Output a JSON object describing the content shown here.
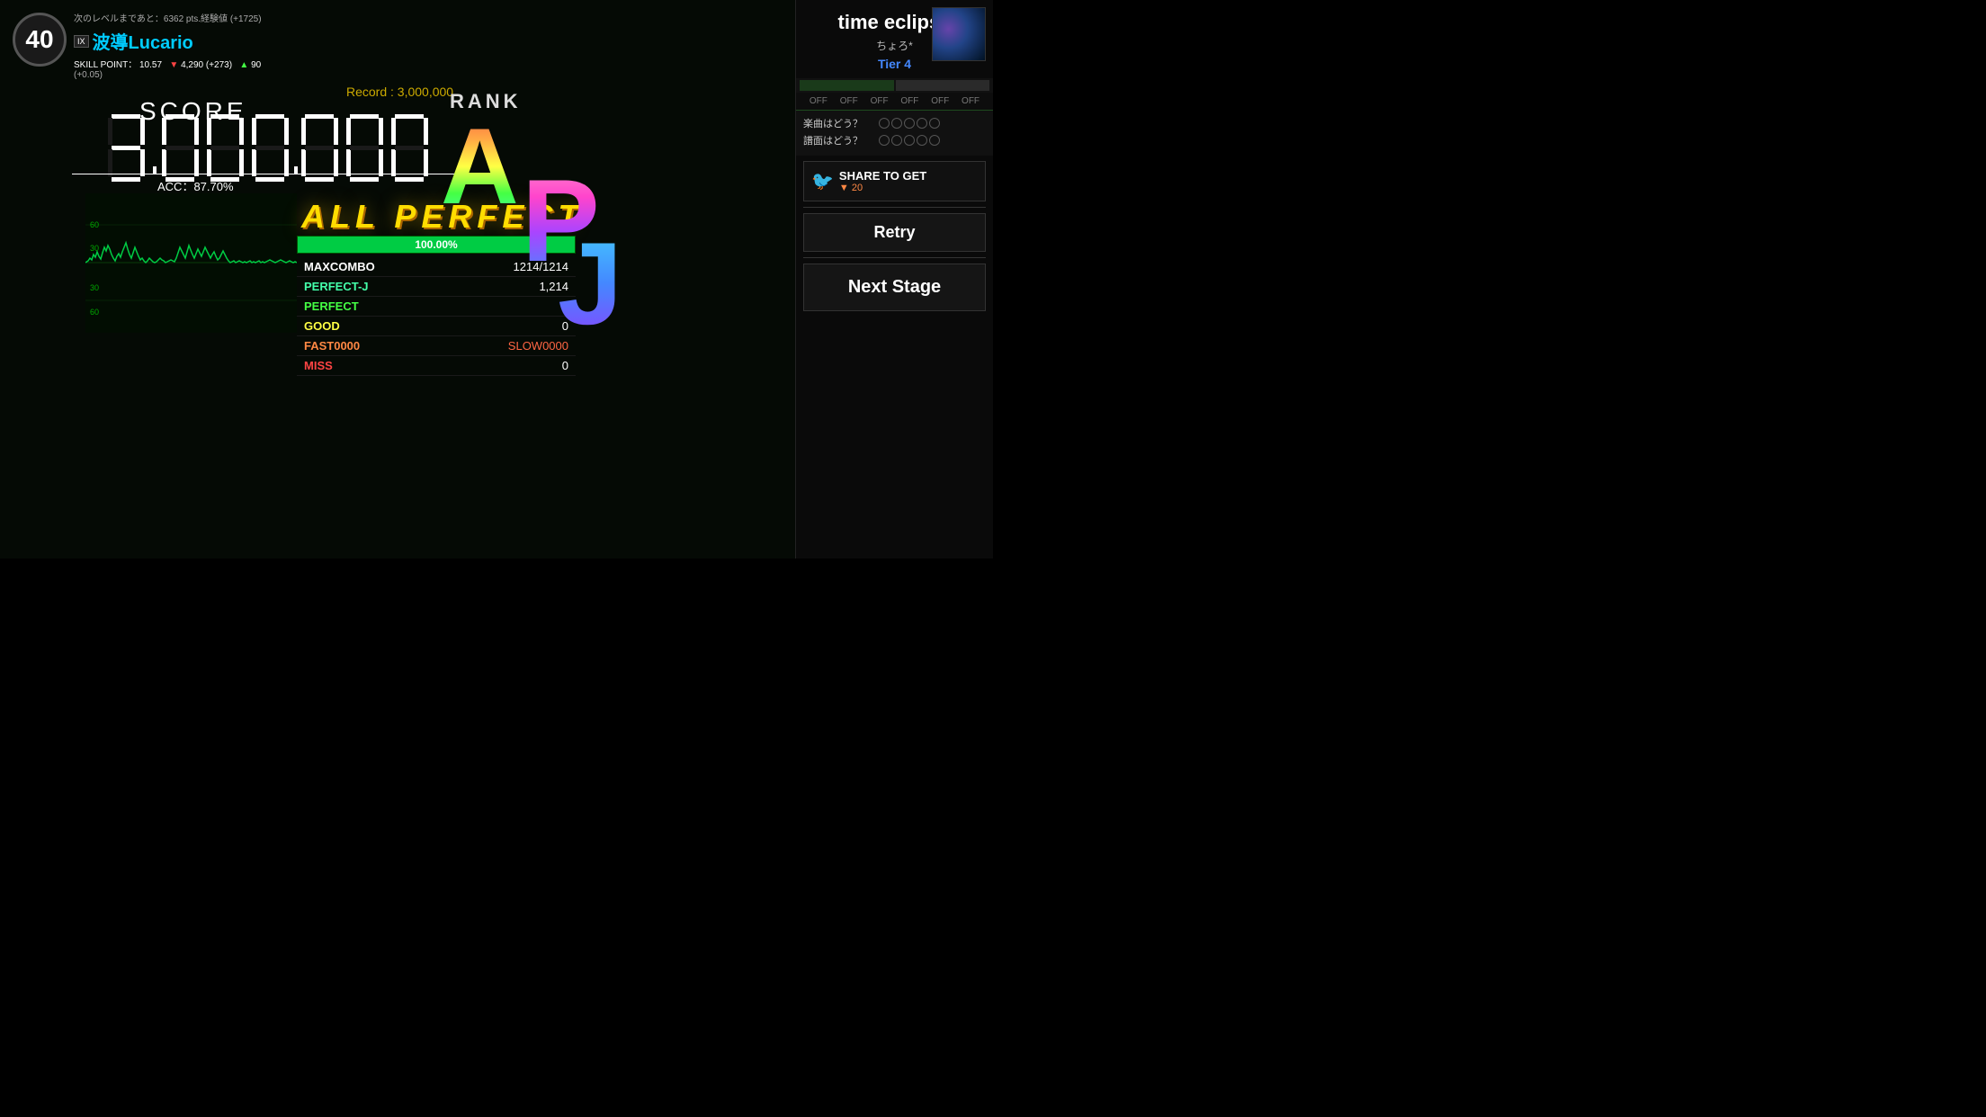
{
  "level": {
    "number": "40"
  },
  "player": {
    "exp_text": "次のレベルまであと：6362 pts.経験値 (+1725)",
    "rank_badge": "IX",
    "name": "波導Lucario",
    "skill_label": "SKILL POINT：",
    "skill_value": "10.57",
    "arrow_down": "▼",
    "stat1": "4,290 (+273)",
    "arrow_up": "▲",
    "stat2": "90",
    "sub_stat": "(+0.05)"
  },
  "song": {
    "title": "time eclipse",
    "artist": "ちょろ*",
    "tier": "Tier 4"
  },
  "record": {
    "label": "Record : 3,000,000"
  },
  "score": {
    "label": "SCORE",
    "value": "3,000,000",
    "acc": "ACC：87.70%"
  },
  "result": {
    "all_perfect": "ALL  PERFECT",
    "progress": "100.00%",
    "maxcombo_label": "MAXCOMBO",
    "maxcombo_value": "1214/1214",
    "perfectj_label": "PERFECT-J",
    "perfectj_value": "1,214",
    "perfect_label": "PERFECT",
    "perfect_value": "0",
    "good_label": "GOOD",
    "good_value": "0",
    "fast_label": "FAST0000",
    "slow_label": "SLOW0000",
    "miss_label": "MISS",
    "miss_value": "0"
  },
  "rank": {
    "label": "RANK",
    "letters": "APJ"
  },
  "toggles": {
    "items": [
      "OFF",
      "OFF",
      "OFF",
      "OFF",
      "OFF",
      "OFF"
    ]
  },
  "rating": {
    "music_label": "楽曲はどう？",
    "chart_label": "譜面はどう？",
    "circles": 5
  },
  "share": {
    "text": "SHARE TO GET",
    "sub": "▼ 20",
    "button_label": "Retry",
    "next_label": "Next Stage"
  }
}
